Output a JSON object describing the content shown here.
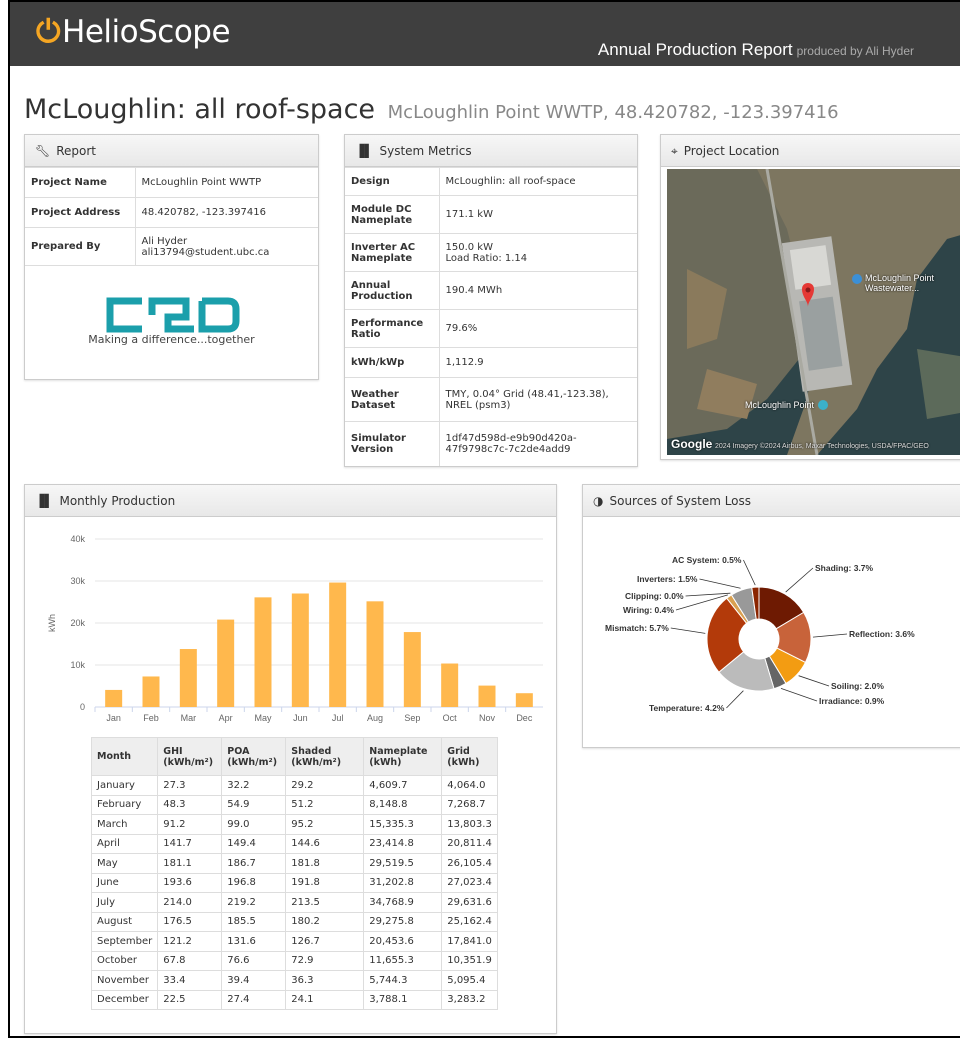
{
  "header": {
    "brand": "HelioScope",
    "brand_icon": "power-icon",
    "report_title": "Annual Production Report",
    "produced_by": "produced by Ali Hyder"
  },
  "page": {
    "title": "McLoughlin: all roof-space",
    "subtitle": "McLoughlin Point WWTP, 48.420782, -123.397416"
  },
  "report": {
    "heading": "Report",
    "rows": [
      {
        "k": "Project Name",
        "v": "McLoughlin Point WWTP"
      },
      {
        "k": "Project Address",
        "v": "48.420782, -123.397416"
      },
      {
        "k": "Prepared By",
        "v": "Ali Hyder",
        "v2": "ali13794@student.ubc.ca"
      }
    ],
    "logo_text": "CRD",
    "logo_tagline": "Making a difference...together",
    "logo_color": "#1b9fab"
  },
  "metrics": {
    "heading": "System Metrics",
    "rows": [
      {
        "k": "Design",
        "v": "McLoughlin: all roof-space"
      },
      {
        "k": "Module DC Nameplate",
        "v": "171.1 kW"
      },
      {
        "k": "Inverter AC Nameplate",
        "v": "150.0 kW",
        "v2": "Load Ratio: 1.14"
      },
      {
        "k": "Annual Production",
        "v": "190.4 MWh"
      },
      {
        "k": "Performance Ratio",
        "v": "79.6%"
      },
      {
        "k": "kWh/kWp",
        "v": "1,112.9"
      },
      {
        "k": "Weather Dataset",
        "v": "TMY, 0.04° Grid (48.41,-123.38), NREL (psm3)"
      },
      {
        "k": "Simulator Version",
        "v": "1df47d598d-e9b90d420a-47f9798c7c-7c2de4add9"
      }
    ]
  },
  "location": {
    "heading": "Project Location",
    "pin_label": "McLoughlin Point Wastewater...",
    "place_label": "McLoughlin Point",
    "google": "Google",
    "attribution": "2024 Imagery ©2024 Airbus, Maxar Technologies, USDA/FPAC/GEO"
  },
  "monthly": {
    "heading": "Monthly Production",
    "table_headers": [
      {
        "a": "Month",
        "b": ""
      },
      {
        "a": "GHI",
        "b": "(kWh/m²)"
      },
      {
        "a": "POA",
        "b": "(kWh/m²)"
      },
      {
        "a": "Shaded",
        "b": "(kWh/m²)"
      },
      {
        "a": "Nameplate",
        "b": "(kWh)"
      },
      {
        "a": "Grid",
        "b": "(kWh)"
      }
    ],
    "table_rows": [
      [
        "January",
        "27.3",
        "32.2",
        "29.2",
        "4,609.7",
        "4,064.0"
      ],
      [
        "February",
        "48.3",
        "54.9",
        "51.2",
        "8,148.8",
        "7,268.7"
      ],
      [
        "March",
        "91.2",
        "99.0",
        "95.2",
        "15,335.3",
        "13,803.3"
      ],
      [
        "April",
        "141.7",
        "149.4",
        "144.6",
        "23,414.8",
        "20,811.4"
      ],
      [
        "May",
        "181.1",
        "186.7",
        "181.8",
        "29,519.5",
        "26,105.4"
      ],
      [
        "June",
        "193.6",
        "196.8",
        "191.8",
        "31,202.8",
        "27,023.4"
      ],
      [
        "July",
        "214.0",
        "219.2",
        "213.5",
        "34,768.9",
        "29,631.6"
      ],
      [
        "August",
        "176.5",
        "185.5",
        "180.2",
        "29,275.8",
        "25,162.4"
      ],
      [
        "September",
        "121.2",
        "131.6",
        "126.7",
        "20,453.6",
        "17,841.0"
      ],
      [
        "October",
        "67.8",
        "76.6",
        "72.9",
        "11,655.3",
        "10,351.9"
      ],
      [
        "November",
        "33.4",
        "39.4",
        "36.3",
        "5,744.3",
        "5,095.4"
      ],
      [
        "December",
        "22.5",
        "27.4",
        "24.1",
        "3,788.1",
        "3,283.2"
      ]
    ]
  },
  "losses": {
    "heading": "Sources of System Loss"
  },
  "chart_data": [
    {
      "type": "bar",
      "title": "",
      "ylabel": "kWh",
      "xlabel": "",
      "categories": [
        "Jan",
        "Feb",
        "Mar",
        "Apr",
        "May",
        "Jun",
        "Jul",
        "Aug",
        "Sep",
        "Oct",
        "Nov",
        "Dec"
      ],
      "values": [
        4064.0,
        7268.7,
        13803.3,
        20811.4,
        26105.4,
        27023.4,
        29631.6,
        25162.4,
        17841.0,
        10351.9,
        5095.4,
        3283.2
      ],
      "ylim": [
        0,
        40000
      ],
      "yticks": [
        0,
        10000,
        20000,
        30000,
        40000
      ],
      "ytick_labels": [
        "0",
        "10k",
        "20k",
        "30k",
        "40k"
      ],
      "grid": true,
      "color": "#ffb84d"
    },
    {
      "type": "pie",
      "style": "donut",
      "title": "",
      "slices": [
        {
          "label": "Shading: 3.7%",
          "value": 3.7,
          "color": "#6e1a02"
        },
        {
          "label": "Reflection: 3.6%",
          "value": 3.6,
          "color": "#c8633a"
        },
        {
          "label": "Soiling: 2.0%",
          "value": 2.0,
          "color": "#f39c12"
        },
        {
          "label": "Irradiance: 0.9%",
          "value": 0.9,
          "color": "#666666"
        },
        {
          "label": "Temperature: 4.2%",
          "value": 4.2,
          "color": "#bbbbbb"
        },
        {
          "label": "Mismatch: 5.7%",
          "value": 5.7,
          "color": "#b33a0a"
        },
        {
          "label": "Wiring: 0.4%",
          "value": 0.4,
          "color": "#d9a050"
        },
        {
          "label": "Clipping: 0.0%",
          "value": 0.0,
          "color": "#3b6ea5"
        },
        {
          "label": "Inverters: 1.5%",
          "value": 1.5,
          "color": "#999999"
        },
        {
          "label": "AC System: 0.5%",
          "value": 0.5,
          "color": "#8b2500"
        }
      ]
    }
  ]
}
